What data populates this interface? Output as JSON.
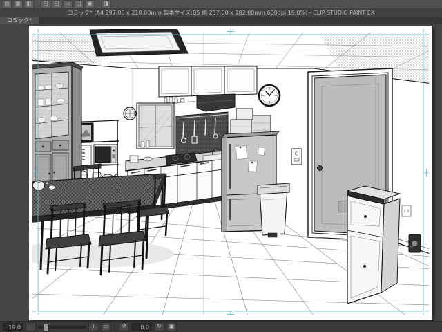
{
  "window": {
    "title": "コミック* (A4 297.00 x 210.00mm 製本サイズ:B5 刷 257.00 x 182.00mm 600dpi 19.0%) - CLIP STUDIO PAINT EX",
    "tab_label": "コミック*"
  },
  "command_bar": {
    "icons": [
      {
        "name": "new",
        "glyph": "▤"
      },
      {
        "name": "open",
        "glyph": "▦"
      },
      {
        "name": "save",
        "glyph": "◧"
      },
      {
        "name": "undo",
        "glyph": "◰"
      },
      {
        "name": "redo",
        "glyph": "◱"
      },
      {
        "name": "cut",
        "glyph": "▭"
      },
      {
        "name": "copy",
        "glyph": "◫"
      },
      {
        "name": "paste",
        "glyph": "▣"
      },
      {
        "name": "settings",
        "glyph": "◨"
      }
    ]
  },
  "status_bar": {
    "zoom_value": "19.0",
    "rotation_value": "0.0",
    "zoom_out_glyph": "−",
    "zoom_in_glyph": "+",
    "fit_glyph": "▭",
    "rotate_ccw_glyph": "↺",
    "rotate_cw_glyph": "↻",
    "reset_glyph": "▣"
  },
  "canvas": {
    "page_color": "#ffffff",
    "guide_color": "#63b8d4",
    "scene": "Monochrome line-art interior: Japanese kitchen-dining room with ceiling light, wall clock, upper cabinets, range hood, sink counter, refrigerator with notes, trash can, gray entry door, microwave shelf, glass hutch, dining table with chairs, tiled floor, low cabinet by the door."
  }
}
